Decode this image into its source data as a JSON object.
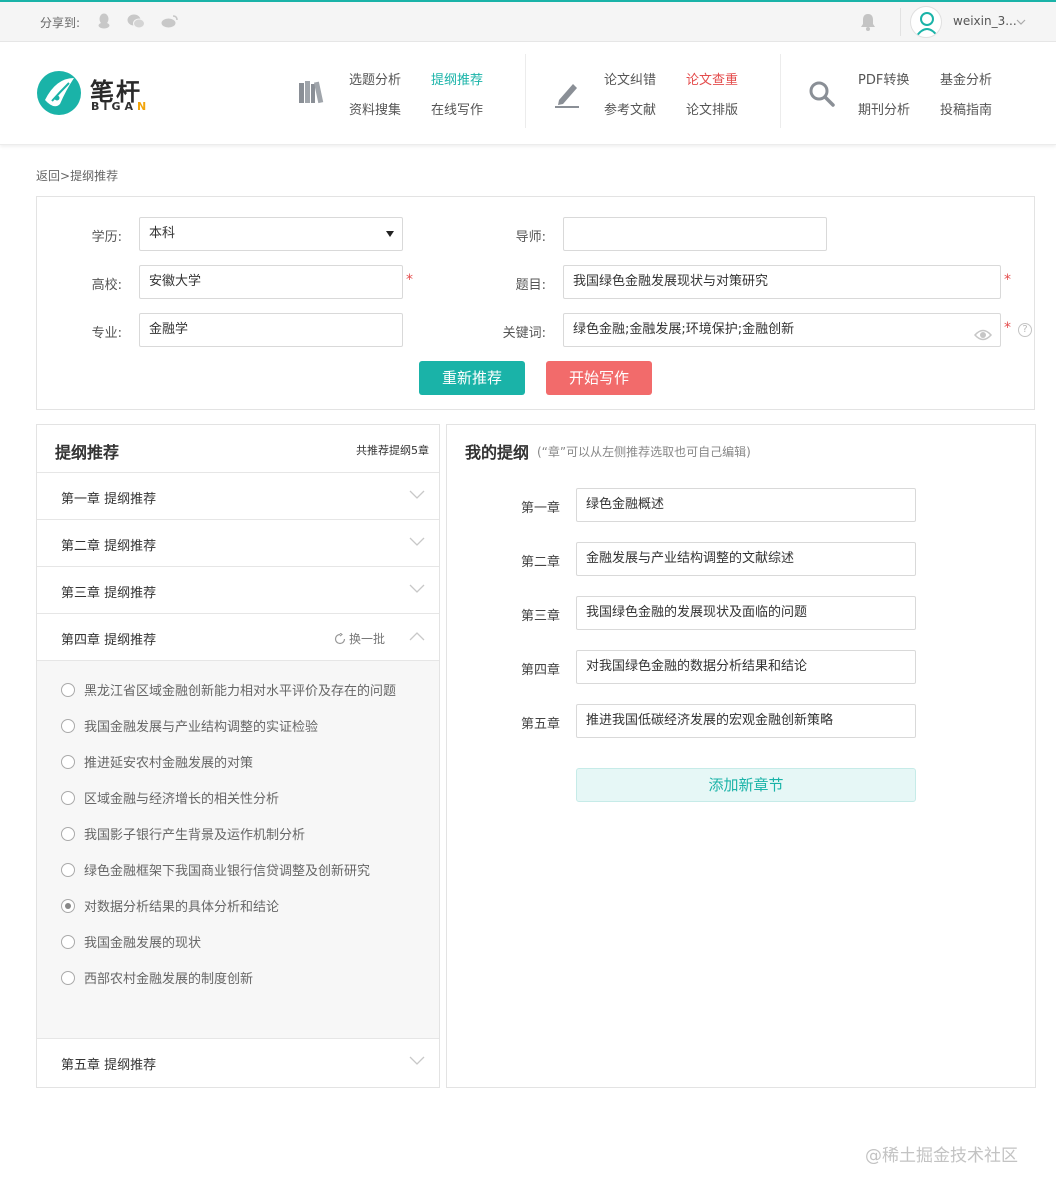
{
  "topbar": {
    "share_label": "分享到:",
    "share_icons": [
      "qq-icon",
      "wechat-icon",
      "weibo-icon"
    ],
    "username": "weixin_3..."
  },
  "brand": {
    "name_cn": "笔杆",
    "name_en_main": "BIGA",
    "name_en_tail": "N",
    "logo_color": "#1ab3a8"
  },
  "nav": {
    "group1": {
      "icon": "books-icon",
      "links": [
        "选题分析",
        "提纲推荐",
        "资料搜集",
        "在线写作"
      ]
    },
    "group2": {
      "icon": "pen-icon",
      "links": [
        "论文纠错",
        "论文查重",
        "参考文献",
        "论文排版"
      ]
    },
    "group3": {
      "icon": "search-icon",
      "links": [
        "PDF转换",
        "基金分析",
        "期刊分析",
        "投稿指南"
      ]
    }
  },
  "breadcrumb": {
    "back": "返回",
    "sep": ">",
    "current": "提纲推荐"
  },
  "form": {
    "education_label": "学历:",
    "education_value": "本科",
    "mentor_label": "导师:",
    "mentor_value": "",
    "school_label": "高校:",
    "school_value": "安徽大学",
    "topic_label": "题目:",
    "topic_value": "我国绿色金融发展现状与对策研究",
    "major_label": "专业:",
    "major_value": "金融学",
    "keywords_label": "关键词:",
    "keywords_value": "绿色金融;金融发展;环境保护;金融创新",
    "required_mark": "*",
    "help_mark": "?",
    "recommend_btn": "重新推荐",
    "write_btn": "开始写作"
  },
  "left_panel": {
    "title": "提纲推荐",
    "count": "共推荐提纲5章",
    "chapters": [
      {
        "label": "第一章  提纲推荐"
      },
      {
        "label": "第二章  提纲推荐"
      },
      {
        "label": "第三章  提纲推荐"
      },
      {
        "label": "第四章  提纲推荐"
      },
      {
        "label": "第五章  提纲推荐"
      }
    ],
    "swap_label": "换一批",
    "options": [
      {
        "text": "黑龙江省区域金融创新能力相对水平评价及存在的问题",
        "selected": false
      },
      {
        "text": "我国金融发展与产业结构调整的实证检验",
        "selected": false
      },
      {
        "text": "推进延安农村金融发展的对策",
        "selected": false
      },
      {
        "text": "区域金融与经济增长的相关性分析",
        "selected": false
      },
      {
        "text": "我国影子银行产生背景及运作机制分析",
        "selected": false
      },
      {
        "text": "绿色金融框架下我国商业银行信贷调整及创新研究",
        "selected": false
      },
      {
        "text": "对数据分析结果的具体分析和结论",
        "selected": true
      },
      {
        "text": "我国金融发展的现状",
        "selected": false
      },
      {
        "text": "西部农村金融发展的制度创新",
        "selected": false
      }
    ]
  },
  "right_panel": {
    "title": "我的提纲",
    "hint": "(“章”可以从左侧推荐选取也可自己编辑)",
    "chapters": [
      {
        "label": "第一章",
        "value": "绿色金融概述"
      },
      {
        "label": "第二章",
        "value": "金融发展与产业结构调整的文献综述"
      },
      {
        "label": "第三章",
        "value": "我国绿色金融的发展现状及面临的问题"
      },
      {
        "label": "第四章",
        "value": "对我国绿色金融的数据分析结果和结论"
      },
      {
        "label": "第五章",
        "value": "推进我国低碳经济发展的宏观金融创新策略"
      }
    ],
    "add_btn": "添加新章节"
  },
  "watermark": "@稀土掘金技术社区",
  "colors": {
    "teal": "#1ab3a8",
    "red": "#f26b6b",
    "nav_red": "#e44c4c"
  }
}
